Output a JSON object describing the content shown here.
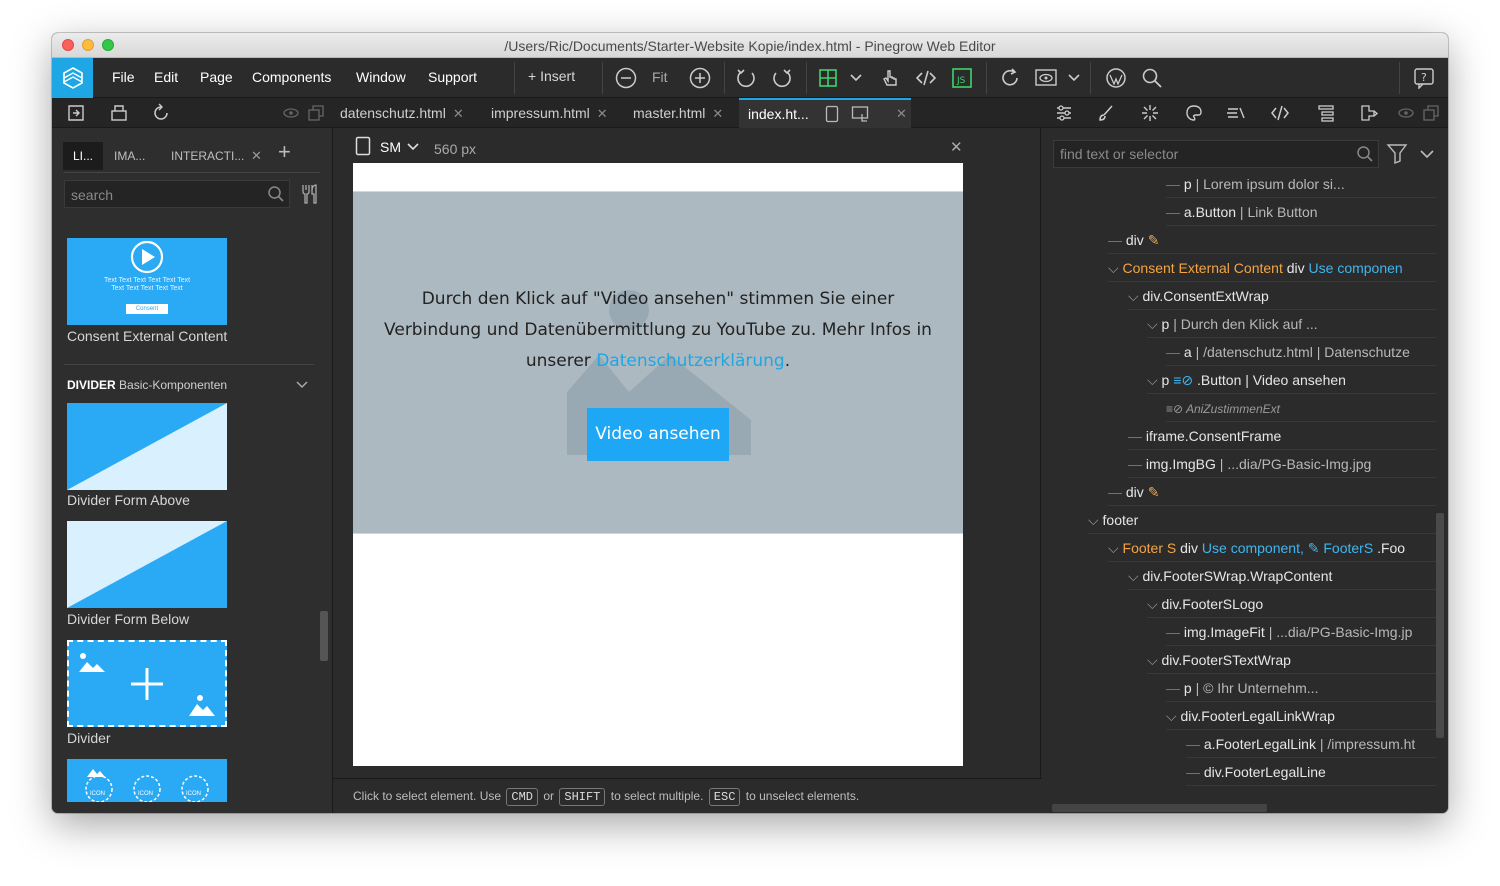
{
  "window": {
    "title": "/Users/Ric/Documents/Starter-Website Kopie/index.html - Pinegrow Web Editor"
  },
  "menu": {
    "items": [
      "File",
      "Edit",
      "Page",
      "Components",
      "Window",
      "Support"
    ],
    "insert_label": "Insert",
    "fit_label": "Fit"
  },
  "tabs": [
    {
      "label": "datenschutz.html"
    },
    {
      "label": "impressum.html"
    },
    {
      "label": "master.html"
    },
    {
      "label": "index.ht...",
      "active": true
    }
  ],
  "left_panel": {
    "tabs": [
      "LI...",
      "IMA...",
      "INTERACTI..."
    ],
    "search_placeholder": "search",
    "consent_thumb_text": "Text Text Text Text Text Text\nText Text Text Text Text",
    "consent_thumb_button": "Consent",
    "components": [
      {
        "label": "Consent External Content"
      },
      {
        "label": "Divider Form Above"
      },
      {
        "label": "Divider Form Below"
      },
      {
        "label": "Divider"
      }
    ],
    "section": {
      "title": "DIVIDER",
      "subtitle": "Basic-Komponenten"
    },
    "icon_thumb_labels": [
      "ICON",
      "ICON",
      "ICON"
    ]
  },
  "canvas": {
    "device": "SM",
    "width_label": "560 px",
    "consent_text_before": "Durch den Klick auf \"Video ansehen\" stimmen Sie einer Verbindung und Datenübermittlung zu YouTube zu. Mehr Infos in unserer ",
    "consent_link": "Datenschutzerklärung",
    "consent_text_after": ".",
    "button_label": "Video ansehen"
  },
  "status": {
    "text1": "Click to select element. Use",
    "key1": "CMD",
    "text2": "or",
    "key2": "SHIFT",
    "text3": "to select multiple.",
    "key3": "ESC",
    "text4": "to unselect elements."
  },
  "right_panel": {
    "search_placeholder": "find text or selector",
    "tree": [
      {
        "tag": "p",
        "sub": " | Lorem ipsum dolor si..."
      },
      {
        "tag": "a.Button",
        "sub": " | Link Button"
      },
      {
        "tag": "div",
        "sub": ""
      },
      {
        "tag": "Consent External Content",
        "sub": " div",
        "extra": "Use componen"
      },
      {
        "tag": "div.ConsentExtWrap",
        "sub": ""
      },
      {
        "tag": "p",
        "sub": " | Durch den Klick auf ..."
      },
      {
        "tag": "a",
        "sub": " | /datenschutz.html | Datenschutze"
      },
      {
        "tag": "p",
        "sub": " .Button | Video ansehen"
      },
      {
        "tag": "AniZustimmenExt",
        "sub": ""
      },
      {
        "tag": "iframe.ConsentFrame",
        "sub": ""
      },
      {
        "tag": "img.ImgBG",
        "sub": " | ...dia/PG-Basic-Img.jpg"
      },
      {
        "tag": "div",
        "sub": ""
      },
      {
        "tag": "footer",
        "sub": ""
      },
      {
        "tag": "Footer S",
        "sub": " div",
        "extra": "Use component,",
        "extra2": "FooterS",
        "extra3": ".Foo"
      },
      {
        "tag": "div.FooterSWrap.WrapContent",
        "sub": ""
      },
      {
        "tag": "div.FooterSLogo",
        "sub": ""
      },
      {
        "tag": "img.ImageFit",
        "sub": " | ...dia/PG-Basic-Img.jp"
      },
      {
        "tag": "div.FooterSTextWrap",
        "sub": ""
      },
      {
        "tag": "p",
        "sub": " | © Ihr Unternehm..."
      },
      {
        "tag": "div.FooterLegalLinkWrap",
        "sub": ""
      },
      {
        "tag": "a.FooterLegalLink",
        "sub": " | /impressum.ht"
      },
      {
        "tag": "div.FooterLegalLine",
        "sub": ""
      }
    ]
  },
  "colors": {
    "accent": "#1ea7e4",
    "component_orange": "#f5a442",
    "thumb_blue": "#2aa9f5",
    "canvas_gray": "#adb9c1"
  }
}
